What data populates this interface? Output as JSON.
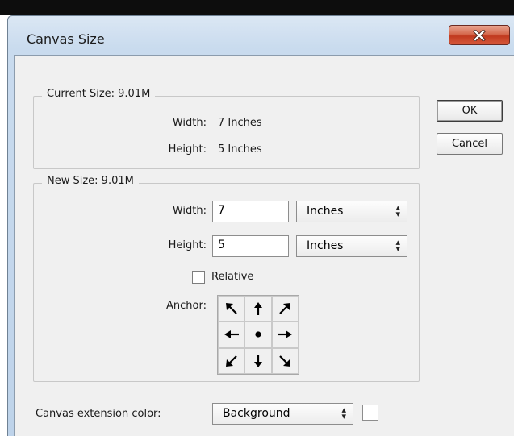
{
  "window": {
    "title": "Canvas Size"
  },
  "current_size": {
    "legend": "Current Size: 9.01M",
    "width_label": "Width:",
    "width_value": "7 Inches",
    "height_label": "Height:",
    "height_value": "5 Inches"
  },
  "new_size": {
    "legend": "New Size: 9.01M",
    "width_label": "Width:",
    "width_value": "7",
    "width_unit": "Inches",
    "height_label": "Height:",
    "height_value": "5",
    "height_unit": "Inches",
    "relative_label": "Relative",
    "relative_checked": false,
    "anchor_label": "Anchor:",
    "anchor_cells": [
      {
        "name": "top-left",
        "icon": "arrow-up-left-icon"
      },
      {
        "name": "top",
        "icon": "arrow-up-icon"
      },
      {
        "name": "top-right",
        "icon": "arrow-up-right-icon"
      },
      {
        "name": "left",
        "icon": "arrow-left-icon"
      },
      {
        "name": "center",
        "icon": "dot-icon",
        "selected": true
      },
      {
        "name": "right",
        "icon": "arrow-right-icon"
      },
      {
        "name": "bottom-left",
        "icon": "arrow-down-left-icon"
      },
      {
        "name": "bottom",
        "icon": "arrow-down-icon"
      },
      {
        "name": "bottom-right",
        "icon": "arrow-down-right-icon"
      }
    ]
  },
  "extension": {
    "label": "Canvas extension color:",
    "value": "Background",
    "swatch_color": "#ffffff"
  },
  "buttons": {
    "ok": "OK",
    "cancel": "Cancel"
  },
  "colors": {
    "close_button": "#c8432a",
    "dialog_background": "#f0f0f0",
    "frame": "#c9dbee"
  }
}
